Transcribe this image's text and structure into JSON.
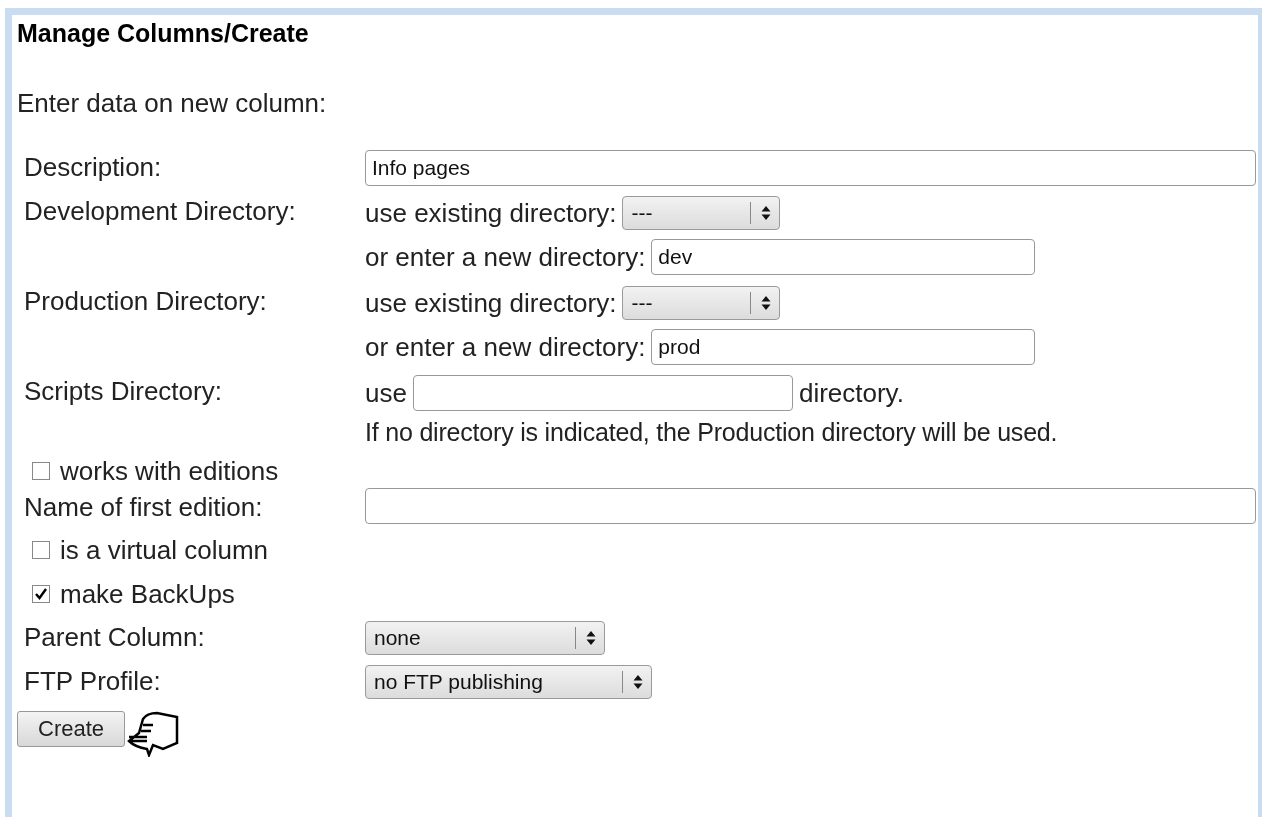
{
  "title": "Manage Columns/Create",
  "intro": "Enter data on new column:",
  "description": {
    "label": "Description:",
    "value": "Info pages"
  },
  "directories": [
    {
      "label": "Development Directory:",
      "existing_label": "use existing directory:",
      "existing_value": "---",
      "new_label": "or enter a new directory:",
      "new_value": "dev"
    },
    {
      "label": "Production Directory:",
      "existing_label": "use existing directory:",
      "existing_value": "---",
      "new_label": "or enter a new directory:",
      "new_value": "prod"
    }
  ],
  "scripts": {
    "label": "Scripts Directory:",
    "prefix": "use",
    "suffix": "directory.",
    "note": "If no directory is indicated, the Production directory will be used."
  },
  "editions": {
    "checkbox_label": "works with editions",
    "checked": false,
    "name_label": "Name of first edition:"
  },
  "options": [
    {
      "label": "is a virtual column",
      "checked": false
    },
    {
      "label": "make BackUps",
      "checked": true
    }
  ],
  "selects": [
    {
      "label": "Parent Column:",
      "value": "none"
    },
    {
      "label": "FTP Profile:",
      "value": "no FTP publishing"
    }
  ],
  "button": "Create"
}
